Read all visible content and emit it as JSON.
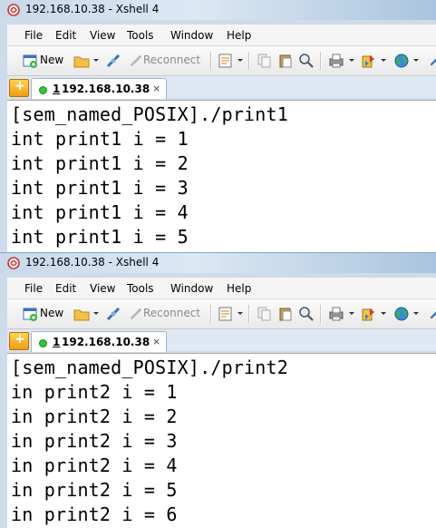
{
  "windows": [
    {
      "title": "192.168.10.38 - Xshell 4",
      "menu": [
        "File",
        "Edit",
        "View",
        "Tools",
        "Window",
        "Help"
      ],
      "toolbar": {
        "new_label": "New",
        "reconnect_label": "Reconnect"
      },
      "tab": {
        "number": "1",
        "label": "192.168.10.38",
        "close": "×"
      },
      "lines": [
        "[sem_named_POSIX]./print1",
        "int print1 i = 1",
        "int print1 i = 2",
        "int print1 i = 3",
        "int print1 i = 4",
        "int print1 i = 5"
      ]
    },
    {
      "title": "192.168.10.38 - Xshell 4",
      "menu": [
        "File",
        "Edit",
        "View",
        "Tools",
        "Window",
        "Help"
      ],
      "toolbar": {
        "new_label": "New",
        "reconnect_label": "Reconnect"
      },
      "tab": {
        "number": "1",
        "label": "192.168.10.38",
        "close": "×"
      },
      "lines": [
        "[sem_named_POSIX]./print2",
        "in print2 i = 1",
        "in print2 i = 2",
        "in print2 i = 3",
        "in print2 i = 4",
        "in print2 i = 5",
        "in print2 i = 6"
      ]
    }
  ],
  "colors": {
    "title_bar": "#dce8f4",
    "tab_status": "#35c435",
    "terminal_bg": "#ffffff",
    "terminal_fg": "#000000"
  },
  "icons": [
    "xshell-app-icon",
    "new-session-icon",
    "open-folder-icon",
    "connect-icon",
    "reconnect-icon",
    "properties-icon",
    "copy-icon",
    "paste-icon",
    "find-icon",
    "print-icon",
    "transfer-icon",
    "globe-icon",
    "add-tab-icon"
  ]
}
